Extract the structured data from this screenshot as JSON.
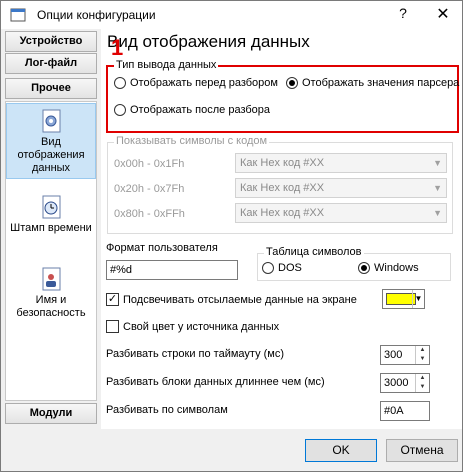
{
  "window": {
    "title": "Опции конфигурации",
    "help_glyph": "?",
    "close_glyph": "✕"
  },
  "sidebar": {
    "top_buttons": [
      "Устройство",
      "Лог-файл",
      "Прочее"
    ],
    "items": [
      {
        "label": "Вид отображения данных",
        "icon": "gear-document-icon",
        "selected": true
      },
      {
        "label": "Штамп времени",
        "icon": "clock-document-icon",
        "selected": false
      },
      {
        "label": "Имя и безопасность",
        "icon": "user-document-icon",
        "selected": false
      }
    ],
    "bottom_button": "Модули"
  },
  "main": {
    "heading": "Вид отображения данных",
    "red_mark": "1",
    "output_type": {
      "legend": "Тип вывода данных",
      "options": [
        "Отображать перед разбором",
        "Отображать значения парсера",
        "Отображать после разбора"
      ],
      "selected_index": 1
    },
    "show_symbols": {
      "legend": "Показывать символы с кодом",
      "rows": [
        {
          "range": "0x00h - 0x1Fh",
          "value": "Как Hex код #XX"
        },
        {
          "range": "0x20h - 0x7Fh",
          "value": "Как Hex код #XX"
        },
        {
          "range": "0x80h - 0xFFh",
          "value": "Как Hex код #XX"
        }
      ]
    },
    "user_format": {
      "label": "Формат пользователя",
      "value": "#%d"
    },
    "charset": {
      "legend": "Таблица символов",
      "options": [
        "DOS",
        "Windows"
      ],
      "selected_index": 1
    },
    "highlight_sent": {
      "label": "Подсвечивать отсылаемые данные на экране",
      "checked": true,
      "color": "#ffff00"
    },
    "own_color": {
      "label": "Свой цвет у источника данных",
      "checked": false
    },
    "split_timeout": {
      "label": "Разбивать строки по таймауту (мс)",
      "value": "300"
    },
    "split_longer": {
      "label": "Разбивать блоки данных длиннее чем (мс)",
      "value": "3000"
    },
    "split_symbols": {
      "label": "Разбивать по символам",
      "value": "#0A"
    }
  },
  "footer": {
    "ok_label": "OK",
    "cancel_label": "Отмена"
  },
  "colors": {
    "accent_red": "#e00000",
    "selection": "#cce4f7",
    "default_button_border": "#0078d7"
  }
}
